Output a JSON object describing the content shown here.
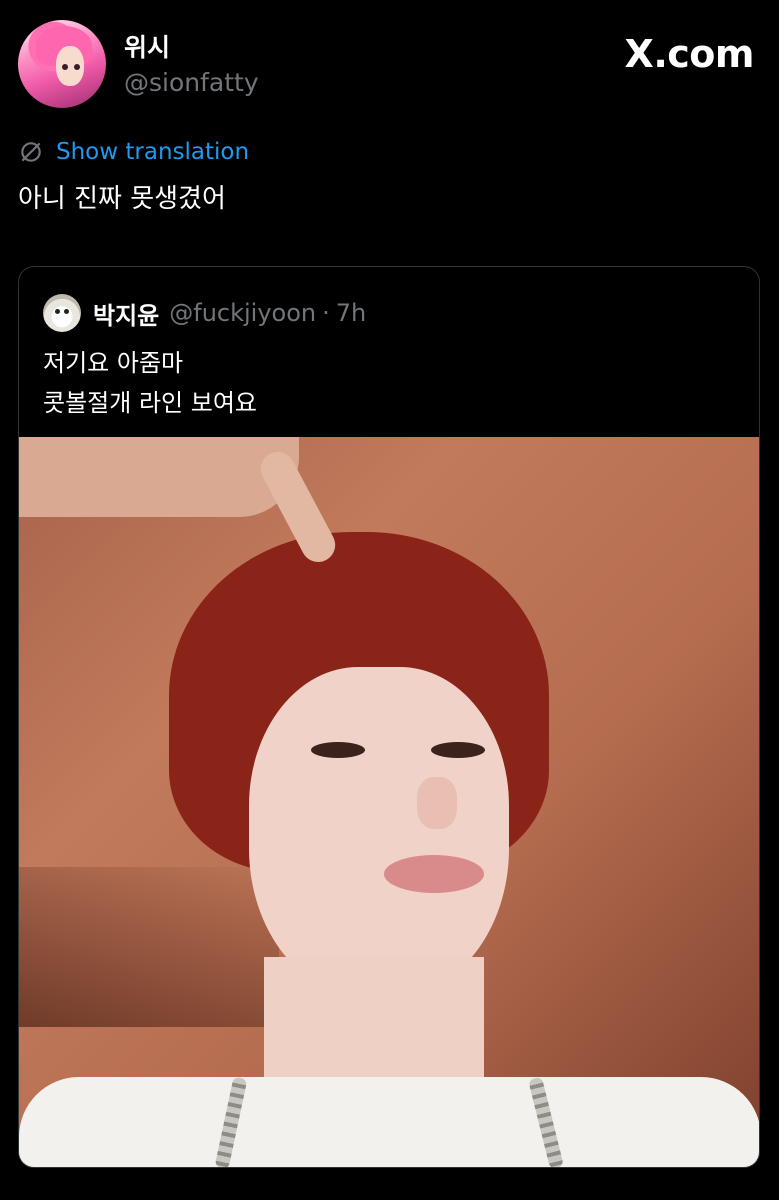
{
  "tweet": {
    "author": {
      "display_name": "위시",
      "handle": "@sionfatty"
    },
    "brand": "X.com",
    "translate_label": "Show translation",
    "text": "아니 진짜 못생겼어"
  },
  "quoted_tweet": {
    "author": {
      "display_name": "박지윤",
      "handle": "@fuckjiyoon"
    },
    "separator": "·",
    "time": "7h",
    "lines": [
      "저기요 아줌마",
      "콧볼절개 라인 보여요"
    ]
  },
  "colors": {
    "background": "#000000",
    "link": "#1d9bf0",
    "muted": "#71767b",
    "border": "#2f3336"
  },
  "icons": {
    "translate": "globe-slash-icon"
  }
}
